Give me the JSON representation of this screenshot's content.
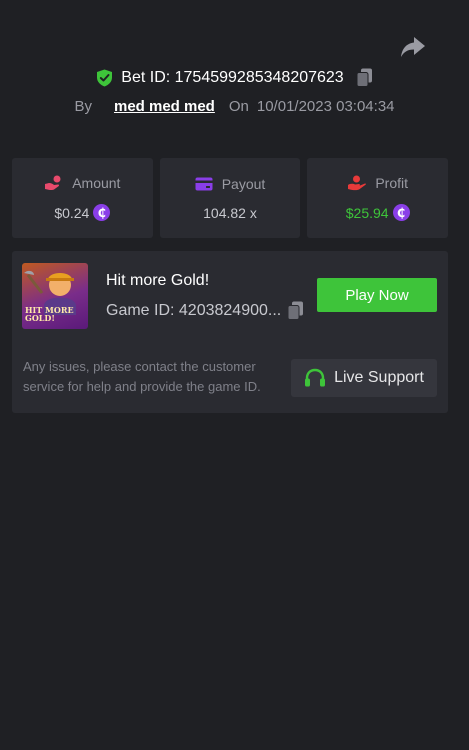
{
  "header": {
    "bet_id_label": "Bet ID: 1754599285348207623",
    "by_label": "By",
    "username": "med med med",
    "on_label": "On",
    "datetime": "10/01/2023 03:04:34"
  },
  "stats": {
    "amount": {
      "label": "Amount",
      "value": "$0.24"
    },
    "payout": {
      "label": "Payout",
      "value": "104.82 x"
    },
    "profit": {
      "label": "Profit",
      "value": "$25.94"
    }
  },
  "game": {
    "thumbnail_text": "HIT MORE GOLD!",
    "title": "Hit more Gold!",
    "game_id": "Game ID: 4203824900...",
    "play_label": "Play Now",
    "support_text": "Any issues, please contact the customer service for help and provide the game ID.",
    "support_label": "Live Support"
  },
  "coin_symbol": "₵",
  "colors": {
    "background": "#1f2024",
    "card": "#2a2b31",
    "accent_green": "#3ec43a",
    "coin_purple": "#8a3ee8",
    "amount_icon": "#e84a6c",
    "payout_icon": "#8a3ee8",
    "profit_icon": "#e83a3a"
  },
  "icons": {
    "share": "share-icon",
    "shield": "shield-check-icon",
    "copy": "copy-icon",
    "amount": "hand-coin-icon",
    "payout": "wallet-icon",
    "profit": "money-hand-icon",
    "support": "headset-icon"
  }
}
